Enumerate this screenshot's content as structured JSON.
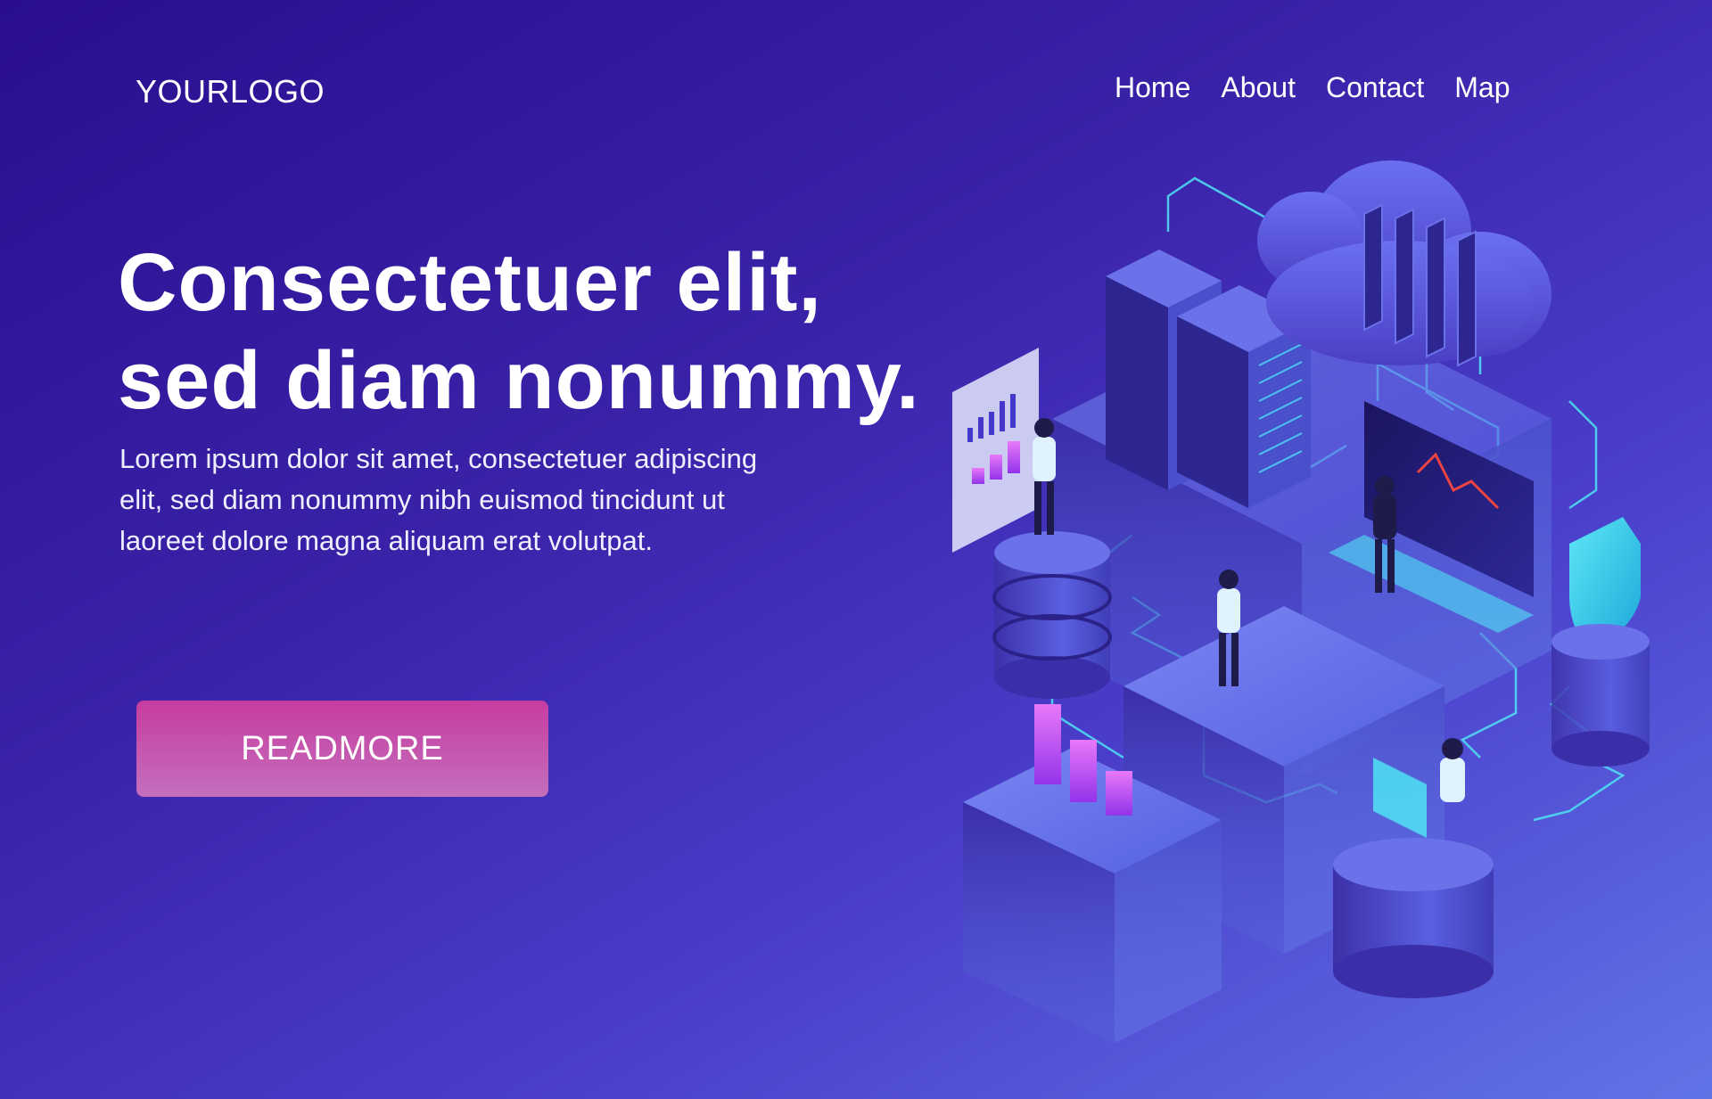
{
  "header": {
    "logo_text": "YOURLOGO",
    "nav": [
      "Home",
      "About",
      "Contact",
      "Map"
    ]
  },
  "hero": {
    "headline_line1": "Consectetuer elit,",
    "headline_line2": "sed diam nonummy.",
    "body_line1": "Lorem ipsum dolor sit amet, consectetuer adipiscing",
    "body_line2": "elit, sed diam nonummy nibh euismod tincidunt ut",
    "body_line3": "laoreet dolore magna aliquam erat volutpat.",
    "cta_label": "READMORE"
  },
  "colors": {
    "background_start": "#2a0e8f",
    "background_end": "#6174e6",
    "cta_start": "#c63c9f",
    "cta_end": "#c46fbd",
    "accent_cyan": "#4fe3f5"
  }
}
